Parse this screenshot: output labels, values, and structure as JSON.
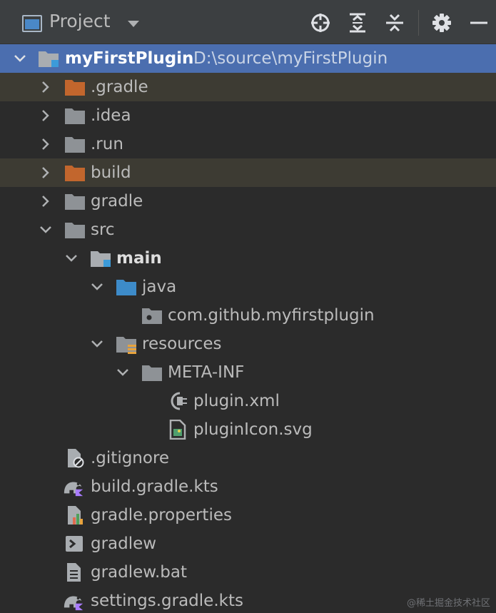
{
  "toolbar": {
    "title": "Project",
    "buttons": [
      "locate-icon",
      "expand-all-icon",
      "collapse-all-icon",
      "gear-icon",
      "minimize-icon"
    ]
  },
  "tree": {
    "root": {
      "name": "myFirstPlugin",
      "path": "D:\\source\\myFirstPlugin"
    },
    "items": [
      {
        "label": ".gradle"
      },
      {
        "label": ".idea"
      },
      {
        "label": ".run"
      },
      {
        "label": "build"
      },
      {
        "label": "gradle"
      },
      {
        "label": "src"
      },
      {
        "label": "main"
      },
      {
        "label": "java"
      },
      {
        "label": "com.github.myfirstplugin"
      },
      {
        "label": "resources"
      },
      {
        "label": "META-INF"
      },
      {
        "label": "plugin.xml"
      },
      {
        "label": "pluginIcon.svg"
      },
      {
        "label": ".gitignore"
      },
      {
        "label": "build.gradle.kts"
      },
      {
        "label": "gradle.properties"
      },
      {
        "label": "gradlew"
      },
      {
        "label": "gradlew.bat"
      },
      {
        "label": "settings.gradle.kts"
      }
    ]
  },
  "watermark": "@稀土掘金技术社区",
  "colors": {
    "selection": "#4b6eaf",
    "excluded_folder": "#c2662d",
    "folder": "#8e9296",
    "source_folder": "#3d8bc9",
    "panel_bg": "#2b2b2b"
  }
}
